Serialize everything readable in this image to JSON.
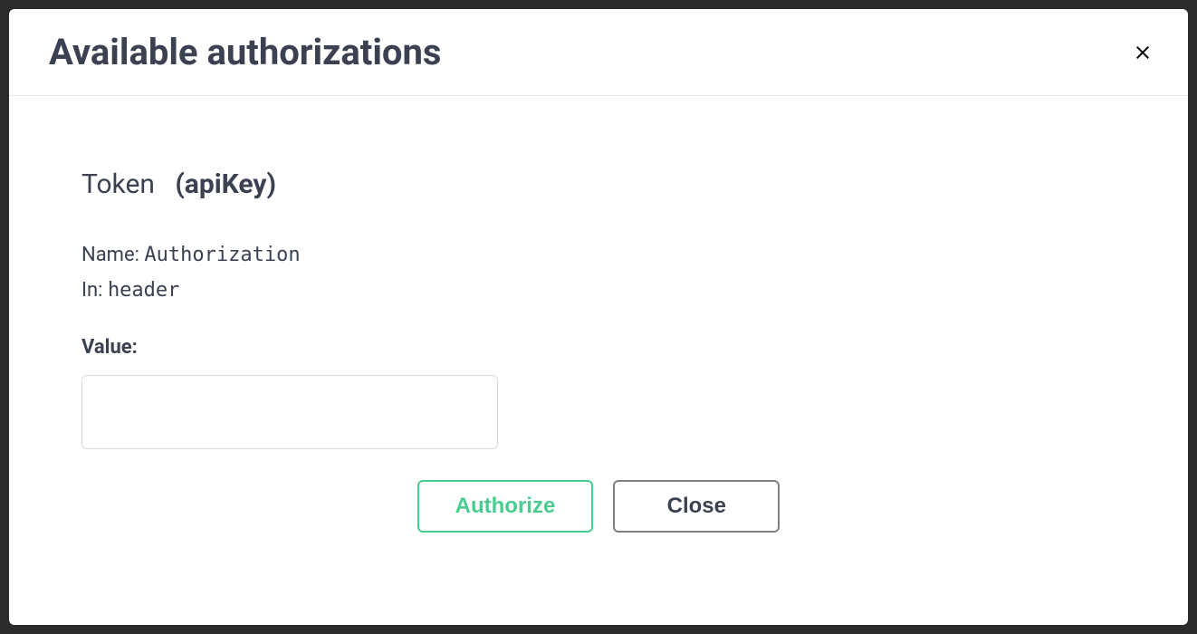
{
  "modal": {
    "title": "Available authorizations",
    "auth": {
      "name": "Token",
      "type": "(apiKey)",
      "name_label": "Name:",
      "name_value": "Authorization",
      "in_label": "In:",
      "in_value": "header",
      "value_label": "Value:",
      "value_input": ""
    },
    "buttons": {
      "authorize": "Authorize",
      "close": "Close"
    }
  }
}
